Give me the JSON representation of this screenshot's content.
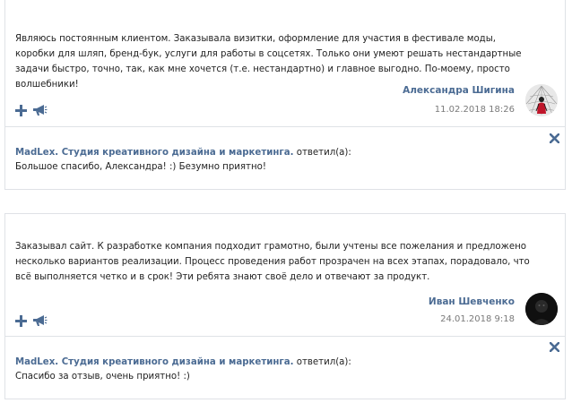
{
  "reviews": [
    {
      "text": "Являюсь постоянным клиентом. Заказывала визитки, оформление для участия в фестивале моды, коробки для шляп, бренд-бук, услуги для работы в соцсетях. Только они умеют решать нестандартные задачи быстро, точно, так, как мне хочется (т.е. нестандартно) и главное выгодно. По-моему, просто волшебники!",
      "author": "Александра Шигина",
      "date": "11.02.2018 18:26",
      "reply": {
        "org": "MadLex. Студия креативного дизайна и маркетинга.",
        "suffix": " ответил(а):",
        "text": "Большое спасибо, Александра! :) Безумно приятно!"
      }
    },
    {
      "text": "Заказывал сайт. К разработке компания подходит грамотно, были учтены все пожелания и предложено несколько вариантов реализации. Процесс проведения работ прозрачен на всех этапах, порадовало, что всё выполняется четко и в срок! Эти ребята знают своё дело и отвечают за продукт.",
      "author": "Иван Шевченко",
      "date": "24.01.2018 9:18",
      "reply": {
        "org": "MadLex. Студия креативного дизайна и маркетинга.",
        "suffix": " ответил(а):",
        "text": "Спасибо за отзыв, очень приятно! :)"
      }
    }
  ],
  "icons": {
    "plus": "plus-icon",
    "megaphone": "megaphone-icon",
    "close": "close-icon"
  },
  "colors": {
    "link": "#4b6b93",
    "icon": "#4b6b93",
    "border": "#dfe2e6",
    "date": "#7a7a7a"
  }
}
